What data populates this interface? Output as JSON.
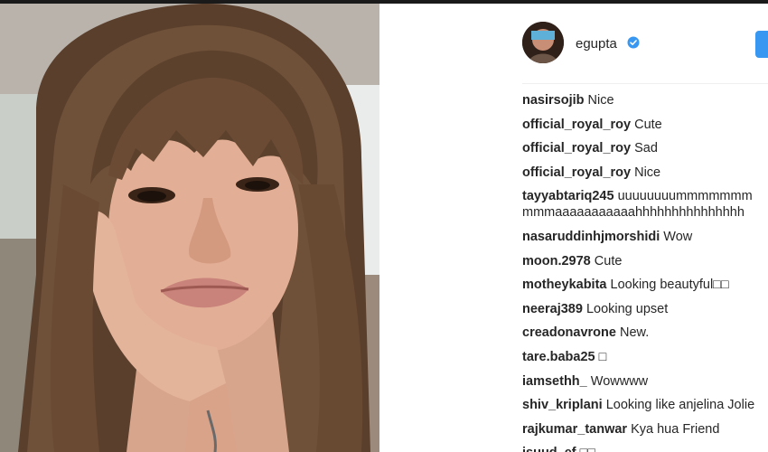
{
  "post": {
    "username": "egupta",
    "verified": true,
    "icons": {
      "avatar": "avatar",
      "verified": "verified-badge-icon",
      "follow": "follow-button"
    },
    "colors": {
      "accent": "#3897f0",
      "text": "#262626"
    }
  },
  "comments": [
    {
      "user": "nasirsojib",
      "text": "Nice"
    },
    {
      "user": "official_royal_roy",
      "text": "Cute"
    },
    {
      "user": "official_royal_roy",
      "text": "Sad"
    },
    {
      "user": "official_royal_roy",
      "text": "Nice"
    },
    {
      "user": "tayyabtariq245",
      "text": "uuuuuuuummmmmmm",
      "text2": "mmmaaaaaaaaaaahhhhhhhhhhhhhhh"
    },
    {
      "user": "nasaruddinhjmorshidi",
      "text": "Wow"
    },
    {
      "user": "moon.2978",
      "text": "Cute"
    },
    {
      "user": "motheykabita",
      "text": "Looking beautyful□□"
    },
    {
      "user": "neeraj389",
      "text": "Looking upset"
    },
    {
      "user": "creadonavrone",
      "text": "New."
    },
    {
      "user": "tare.baba25",
      "text": "□"
    },
    {
      "user": "iamsethh_",
      "text": "Wowwww"
    },
    {
      "user": "shiv_kriplani",
      "text": "Looking like anjelina Jolie"
    },
    {
      "user": "rajkumar_tanwar",
      "text": "Kya hua Friend"
    },
    {
      "user": "jsuud_ef",
      "text": "□□"
    }
  ]
}
